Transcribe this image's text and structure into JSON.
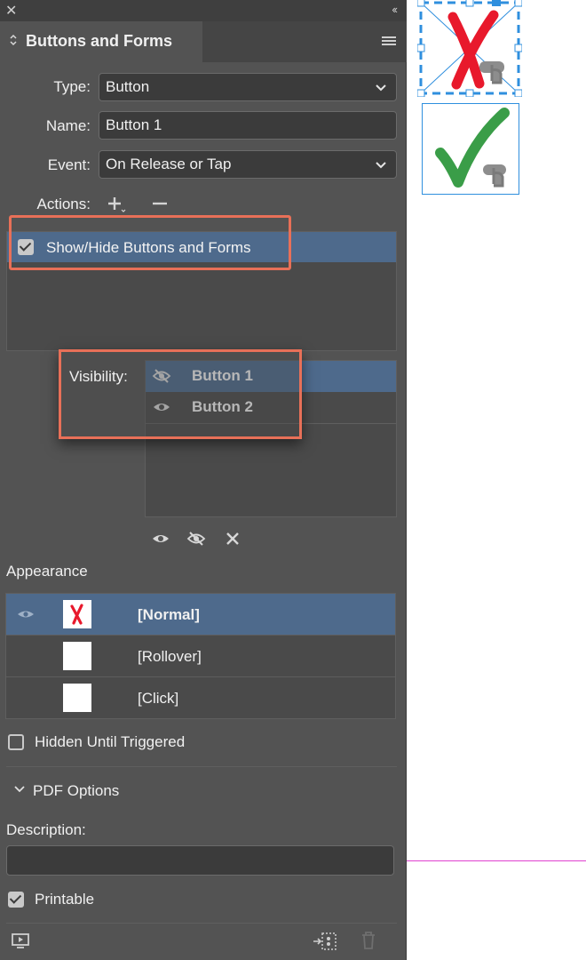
{
  "panel": {
    "close_glyph": "✕",
    "collapse_glyph": "‹‹",
    "title": "Buttons and Forms"
  },
  "form": {
    "type_label": "Type:",
    "type_value": "Button",
    "name_label": "Name:",
    "name_value": "Button 1",
    "event_label": "Event:",
    "event_value": "On Release or Tap",
    "actions_label": "Actions:"
  },
  "actions": [
    {
      "label": "Show/Hide Buttons and Forms",
      "checked": true
    }
  ],
  "visibility": {
    "label": "Visibility:",
    "items": [
      {
        "name": "Button 1",
        "icon": "eye-hidden-icon",
        "selected": true
      },
      {
        "name": "Button 2",
        "icon": "eye-icon",
        "selected": false
      }
    ]
  },
  "appearance": {
    "title": "Appearance",
    "states": [
      {
        "label": "[Normal]",
        "selected": true,
        "thumb": "red-x"
      },
      {
        "label": "[Rollover]",
        "selected": false,
        "thumb": "blank"
      },
      {
        "label": "[Click]",
        "selected": false,
        "thumb": "blank"
      }
    ]
  },
  "options": {
    "hidden_until_triggered": "Hidden Until Triggered",
    "hidden_checked": false,
    "pdf_options": "PDF Options",
    "description_label": "Description:",
    "description_value": "",
    "printable": "Printable",
    "printable_checked": true
  },
  "colors": {
    "panel_bg": "#535353",
    "selection": "#4e6a8c",
    "callout": "#e87058",
    "frame_blue": "#2f8fde",
    "x_red": "#e8192c",
    "check_green": "#3a9d48",
    "guide_magenta": "#e040d0"
  }
}
